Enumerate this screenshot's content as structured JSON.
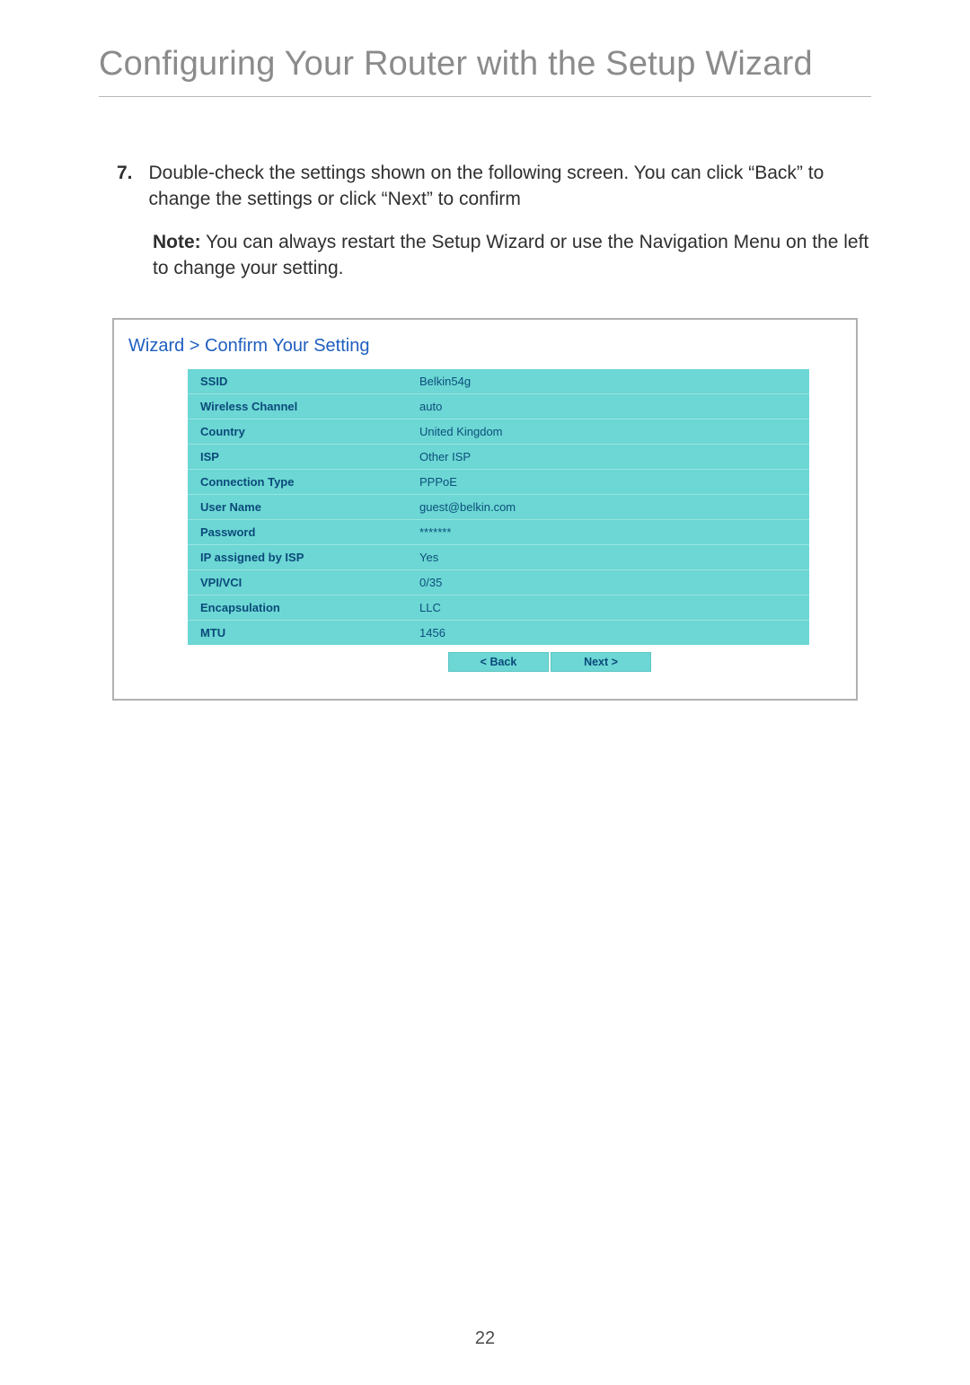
{
  "title": "Configuring Your Router with the Setup Wizard",
  "step": {
    "number": "7.",
    "text": "Double-check the settings shown on the following screen. You can click “Back” to change the settings or click “Next” to confirm"
  },
  "note": {
    "label": "Note:",
    "text": " You can always restart the Setup Wizard or use the Navigation Menu on the left to change your setting."
  },
  "wizard": {
    "breadcrumb": "Wizard > Confirm Your Setting",
    "rows": [
      {
        "label": "SSID",
        "value": "Belkin54g"
      },
      {
        "label": "Wireless Channel",
        "value": "auto"
      },
      {
        "label": "Country",
        "value": "United Kingdom"
      },
      {
        "label": "ISP",
        "value": "Other ISP"
      },
      {
        "label": "Connection Type",
        "value": "PPPoE"
      },
      {
        "label": "User Name",
        "value": "guest@belkin.com"
      },
      {
        "label": "Password",
        "value": "*******"
      },
      {
        "label": "IP assigned by ISP",
        "value": "Yes"
      },
      {
        "label": "VPI/VCI",
        "value": "0/35"
      },
      {
        "label": "Encapsulation",
        "value": "LLC"
      },
      {
        "label": "MTU",
        "value": "1456"
      }
    ],
    "back_label": "< Back",
    "next_label": "Next >"
  },
  "page_number": "22"
}
